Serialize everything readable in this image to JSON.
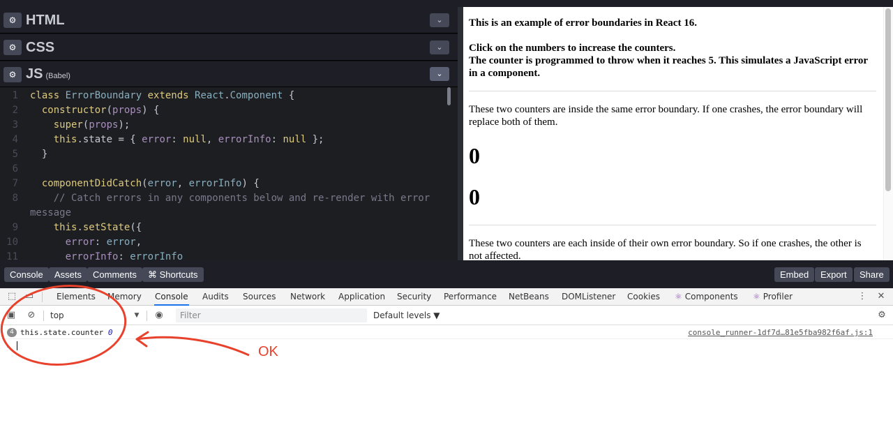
{
  "editor": {
    "panels": [
      {
        "name": "HTML",
        "sub": ""
      },
      {
        "name": "CSS",
        "sub": ""
      },
      {
        "name": "JS",
        "sub": "(Babel)"
      }
    ],
    "gear_glyph": "⚙",
    "chevron_glyph": "⌄",
    "line_numbers": [
      "1",
      "2",
      "3",
      "4",
      "5",
      "6",
      "7",
      "8",
      "",
      "9",
      "10",
      "11"
    ],
    "code_lines": [
      [
        [
          "kw",
          "class "
        ],
        [
          "cls",
          "ErrorBoundary "
        ],
        [
          "kw",
          "extends "
        ],
        [
          "cls",
          "React"
        ],
        [
          "",
          "."
        ],
        [
          "cls",
          "Component "
        ],
        [
          "",
          "{"
        ]
      ],
      [
        [
          "",
          "  "
        ],
        [
          "fn",
          "constructor"
        ],
        [
          "",
          "("
        ],
        [
          "str",
          "props"
        ],
        [
          "",
          ") {"
        ]
      ],
      [
        [
          "",
          "    "
        ],
        [
          "kw",
          "super"
        ],
        [
          "",
          "("
        ],
        [
          "str",
          "props"
        ],
        [
          "",
          ");"
        ]
      ],
      [
        [
          "",
          "    "
        ],
        [
          "kw",
          "this"
        ],
        [
          "",
          ".state = { "
        ],
        [
          "str",
          "error"
        ],
        [
          "",
          ": "
        ],
        [
          "val",
          "null"
        ],
        [
          "",
          ", "
        ],
        [
          "str",
          "errorInfo"
        ],
        [
          "",
          ": "
        ],
        [
          "val",
          "null"
        ],
        [
          "",
          " };"
        ]
      ],
      [
        [
          "",
          "  }"
        ]
      ],
      [
        [
          "",
          ""
        ]
      ],
      [
        [
          "",
          "  "
        ],
        [
          "fn",
          "componentDidCatch"
        ],
        [
          "",
          "("
        ],
        [
          "vn",
          "error"
        ],
        [
          "",
          ", "
        ],
        [
          "vn",
          "errorInfo"
        ],
        [
          "",
          ") {"
        ]
      ],
      [
        [
          "",
          "    "
        ],
        [
          "cm",
          "// Catch errors in any components below and re-render with error"
        ]
      ],
      [
        [
          "cm",
          "message"
        ]
      ],
      [
        [
          "",
          "    "
        ],
        [
          "kw",
          "this"
        ],
        [
          "",
          "."
        ],
        [
          "fn",
          "setState"
        ],
        [
          "",
          "({"
        ]
      ],
      [
        [
          "",
          "      "
        ],
        [
          "str",
          "error"
        ],
        [
          "",
          ": "
        ],
        [
          "vn",
          "error"
        ],
        [
          "",
          ","
        ]
      ],
      [
        [
          "",
          "      "
        ],
        [
          "str",
          "errorInfo"
        ],
        [
          "",
          ": "
        ],
        [
          "vn",
          "errorInfo"
        ]
      ]
    ]
  },
  "preview": {
    "title": "This is an example of error boundaries in React 16.",
    "instr1": "Click on the numbers to increase the counters.",
    "instr2": "The counter is programmed to throw when it reaches 5. This simulates a JavaScript error in a component.",
    "para1": "These two counters are inside the same error boundary. If one crashes, the error boundary will replace both of them.",
    "counter1": "0",
    "counter2": "0",
    "para2": "These two counters are each inside of their own error boundary. So if one crashes, the other is not affected."
  },
  "toolbar": {
    "left": [
      "Console",
      "Assets",
      "Comments",
      "⌘ Shortcuts"
    ],
    "right": [
      "Embed",
      "Export",
      "Share"
    ]
  },
  "devtools": {
    "tabs": [
      "Elements",
      "Memory",
      "Console",
      "Audits",
      "Sources",
      "Network",
      "Application",
      "Security",
      "Performance",
      "NetBeans",
      "DOMListener",
      "Cookies",
      "Components",
      "Profiler"
    ],
    "active_tab": "Console",
    "context": "top",
    "filter_placeholder": "Filter",
    "levels": "Default levels ▼",
    "log": {
      "count": "4",
      "text": "this.state.counter ",
      "value": "0",
      "source": "console_runner-1df7d…81e5fba982f6af.js:1"
    },
    "prompt": "›"
  },
  "annotation": {
    "label": "OK",
    "color": "#e8412c"
  }
}
